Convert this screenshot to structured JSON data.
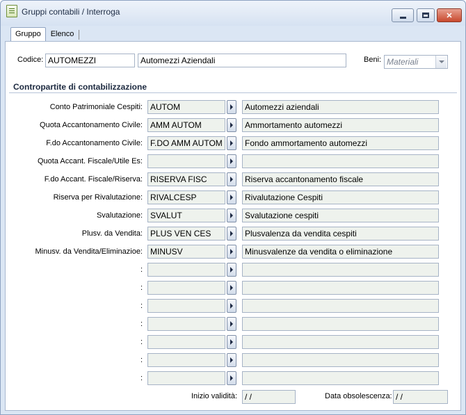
{
  "window": {
    "title": "Gruppi contabili / Interroga",
    "colors": {
      "frame": "#dbe6f4",
      "field_bg": "#eef2ed",
      "close": "#c8492e"
    }
  },
  "tabs": [
    {
      "label": "Gruppo",
      "active": true
    },
    {
      "label": "Elenco",
      "active": false
    }
  ],
  "header": {
    "codice_label": "Codice:",
    "codice_value": "AUTOMEZZI",
    "descrizione_value": "Automezzi Aziendali",
    "beni_label": "Beni:",
    "beni_value": "Materiali"
  },
  "section": {
    "title": "Contropartite di contabilizzazione"
  },
  "rows": [
    {
      "label": "Conto Patrimoniale Cespiti:",
      "code": "AUTOM",
      "description": "Automezzi aziendali"
    },
    {
      "label": "Quota Accantonamento Civile:",
      "code": "AMM AUTOM",
      "description": "Ammortamento automezzi"
    },
    {
      "label": "F.do Accantonamento Civile:",
      "code": "F.DO AMM AUTOM",
      "description": "Fondo ammortamento automezzi"
    },
    {
      "label": "Quota Accant. Fiscale/Utile Es:",
      "code": "",
      "description": ""
    },
    {
      "label": "F.do Accant. Fiscale/Riserva:",
      "code": "RISERVA FISC",
      "description": "Riserva accantonamento fiscale"
    },
    {
      "label": "Riserva per Rivalutazione:",
      "code": "RIVALCESP",
      "description": "Rivalutazione Cespiti"
    },
    {
      "label": "Svalutazione:",
      "code": "SVALUT",
      "description": "Svalutazione cespiti"
    },
    {
      "label": "Plusv. da Vendita:",
      "code": "PLUS VEN CES",
      "description": "Plusvalenza da vendita cespiti"
    },
    {
      "label": "Minusv. da Vendita/Eliminazioe:",
      "code": "MINUSV",
      "description": "Minusvalenze da vendita o eliminazione"
    },
    {
      "label": ":",
      "code": "",
      "description": ""
    },
    {
      "label": ":",
      "code": "",
      "description": ""
    },
    {
      "label": ":",
      "code": "",
      "description": ""
    },
    {
      "label": ":",
      "code": "",
      "description": ""
    },
    {
      "label": ":",
      "code": "",
      "description": ""
    },
    {
      "label": ":",
      "code": "",
      "description": ""
    },
    {
      "label": ":",
      "code": "",
      "description": ""
    }
  ],
  "footer": {
    "inizio_label": "Inizio validità:",
    "inizio_value": " /  /",
    "obsolescenza_label": "Data obsolescenza:",
    "obsolescenza_value": " /  /"
  }
}
